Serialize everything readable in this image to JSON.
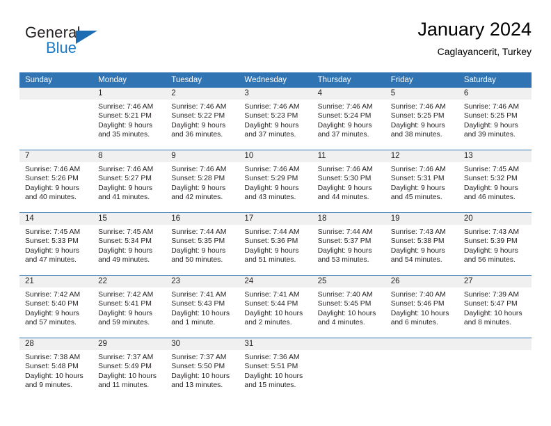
{
  "brand": {
    "name_part1": "General",
    "name_part2": "Blue",
    "logo_icon": "triangle-logo-icon",
    "accent_color": "#1c6cb3"
  },
  "header": {
    "title": "January 2024",
    "subtitle": "Caglayancerit, Turkey"
  },
  "theme": {
    "header_bg": "#3074b4",
    "daynum_bg": "#f0f0f0",
    "text": "#231f20"
  },
  "weekday_headers": [
    "Sunday",
    "Monday",
    "Tuesday",
    "Wednesday",
    "Thursday",
    "Friday",
    "Saturday"
  ],
  "weeks": [
    [
      {
        "day": "",
        "sunrise": "",
        "sunset": "",
        "daylight1": "",
        "daylight2": "",
        "blank": true
      },
      {
        "day": "1",
        "sunrise": "Sunrise: 7:46 AM",
        "sunset": "Sunset: 5:21 PM",
        "daylight1": "Daylight: 9 hours",
        "daylight2": "and 35 minutes."
      },
      {
        "day": "2",
        "sunrise": "Sunrise: 7:46 AM",
        "sunset": "Sunset: 5:22 PM",
        "daylight1": "Daylight: 9 hours",
        "daylight2": "and 36 minutes."
      },
      {
        "day": "3",
        "sunrise": "Sunrise: 7:46 AM",
        "sunset": "Sunset: 5:23 PM",
        "daylight1": "Daylight: 9 hours",
        "daylight2": "and 37 minutes."
      },
      {
        "day": "4",
        "sunrise": "Sunrise: 7:46 AM",
        "sunset": "Sunset: 5:24 PM",
        "daylight1": "Daylight: 9 hours",
        "daylight2": "and 37 minutes."
      },
      {
        "day": "5",
        "sunrise": "Sunrise: 7:46 AM",
        "sunset": "Sunset: 5:25 PM",
        "daylight1": "Daylight: 9 hours",
        "daylight2": "and 38 minutes."
      },
      {
        "day": "6",
        "sunrise": "Sunrise: 7:46 AM",
        "sunset": "Sunset: 5:25 PM",
        "daylight1": "Daylight: 9 hours",
        "daylight2": "and 39 minutes."
      }
    ],
    [
      {
        "day": "7",
        "sunrise": "Sunrise: 7:46 AM",
        "sunset": "Sunset: 5:26 PM",
        "daylight1": "Daylight: 9 hours",
        "daylight2": "and 40 minutes."
      },
      {
        "day": "8",
        "sunrise": "Sunrise: 7:46 AM",
        "sunset": "Sunset: 5:27 PM",
        "daylight1": "Daylight: 9 hours",
        "daylight2": "and 41 minutes."
      },
      {
        "day": "9",
        "sunrise": "Sunrise: 7:46 AM",
        "sunset": "Sunset: 5:28 PM",
        "daylight1": "Daylight: 9 hours",
        "daylight2": "and 42 minutes."
      },
      {
        "day": "10",
        "sunrise": "Sunrise: 7:46 AM",
        "sunset": "Sunset: 5:29 PM",
        "daylight1": "Daylight: 9 hours",
        "daylight2": "and 43 minutes."
      },
      {
        "day": "11",
        "sunrise": "Sunrise: 7:46 AM",
        "sunset": "Sunset: 5:30 PM",
        "daylight1": "Daylight: 9 hours",
        "daylight2": "and 44 minutes."
      },
      {
        "day": "12",
        "sunrise": "Sunrise: 7:46 AM",
        "sunset": "Sunset: 5:31 PM",
        "daylight1": "Daylight: 9 hours",
        "daylight2": "and 45 minutes."
      },
      {
        "day": "13",
        "sunrise": "Sunrise: 7:45 AM",
        "sunset": "Sunset: 5:32 PM",
        "daylight1": "Daylight: 9 hours",
        "daylight2": "and 46 minutes."
      }
    ],
    [
      {
        "day": "14",
        "sunrise": "Sunrise: 7:45 AM",
        "sunset": "Sunset: 5:33 PM",
        "daylight1": "Daylight: 9 hours",
        "daylight2": "and 47 minutes."
      },
      {
        "day": "15",
        "sunrise": "Sunrise: 7:45 AM",
        "sunset": "Sunset: 5:34 PM",
        "daylight1": "Daylight: 9 hours",
        "daylight2": "and 49 minutes."
      },
      {
        "day": "16",
        "sunrise": "Sunrise: 7:44 AM",
        "sunset": "Sunset: 5:35 PM",
        "daylight1": "Daylight: 9 hours",
        "daylight2": "and 50 minutes."
      },
      {
        "day": "17",
        "sunrise": "Sunrise: 7:44 AM",
        "sunset": "Sunset: 5:36 PM",
        "daylight1": "Daylight: 9 hours",
        "daylight2": "and 51 minutes."
      },
      {
        "day": "18",
        "sunrise": "Sunrise: 7:44 AM",
        "sunset": "Sunset: 5:37 PM",
        "daylight1": "Daylight: 9 hours",
        "daylight2": "and 53 minutes."
      },
      {
        "day": "19",
        "sunrise": "Sunrise: 7:43 AM",
        "sunset": "Sunset: 5:38 PM",
        "daylight1": "Daylight: 9 hours",
        "daylight2": "and 54 minutes."
      },
      {
        "day": "20",
        "sunrise": "Sunrise: 7:43 AM",
        "sunset": "Sunset: 5:39 PM",
        "daylight1": "Daylight: 9 hours",
        "daylight2": "and 56 minutes."
      }
    ],
    [
      {
        "day": "21",
        "sunrise": "Sunrise: 7:42 AM",
        "sunset": "Sunset: 5:40 PM",
        "daylight1": "Daylight: 9 hours",
        "daylight2": "and 57 minutes."
      },
      {
        "day": "22",
        "sunrise": "Sunrise: 7:42 AM",
        "sunset": "Sunset: 5:41 PM",
        "daylight1": "Daylight: 9 hours",
        "daylight2": "and 59 minutes."
      },
      {
        "day": "23",
        "sunrise": "Sunrise: 7:41 AM",
        "sunset": "Sunset: 5:43 PM",
        "daylight1": "Daylight: 10 hours",
        "daylight2": "and 1 minute."
      },
      {
        "day": "24",
        "sunrise": "Sunrise: 7:41 AM",
        "sunset": "Sunset: 5:44 PM",
        "daylight1": "Daylight: 10 hours",
        "daylight2": "and 2 minutes."
      },
      {
        "day": "25",
        "sunrise": "Sunrise: 7:40 AM",
        "sunset": "Sunset: 5:45 PM",
        "daylight1": "Daylight: 10 hours",
        "daylight2": "and 4 minutes."
      },
      {
        "day": "26",
        "sunrise": "Sunrise: 7:40 AM",
        "sunset": "Sunset: 5:46 PM",
        "daylight1": "Daylight: 10 hours",
        "daylight2": "and 6 minutes."
      },
      {
        "day": "27",
        "sunrise": "Sunrise: 7:39 AM",
        "sunset": "Sunset: 5:47 PM",
        "daylight1": "Daylight: 10 hours",
        "daylight2": "and 8 minutes."
      }
    ],
    [
      {
        "day": "28",
        "sunrise": "Sunrise: 7:38 AM",
        "sunset": "Sunset: 5:48 PM",
        "daylight1": "Daylight: 10 hours",
        "daylight2": "and 9 minutes."
      },
      {
        "day": "29",
        "sunrise": "Sunrise: 7:37 AM",
        "sunset": "Sunset: 5:49 PM",
        "daylight1": "Daylight: 10 hours",
        "daylight2": "and 11 minutes."
      },
      {
        "day": "30",
        "sunrise": "Sunrise: 7:37 AM",
        "sunset": "Sunset: 5:50 PM",
        "daylight1": "Daylight: 10 hours",
        "daylight2": "and 13 minutes."
      },
      {
        "day": "31",
        "sunrise": "Sunrise: 7:36 AM",
        "sunset": "Sunset: 5:51 PM",
        "daylight1": "Daylight: 10 hours",
        "daylight2": "and 15 minutes."
      },
      {
        "day": "",
        "sunrise": "",
        "sunset": "",
        "daylight1": "",
        "daylight2": "",
        "blank": true
      },
      {
        "day": "",
        "sunrise": "",
        "sunset": "",
        "daylight1": "",
        "daylight2": "",
        "blank": true
      },
      {
        "day": "",
        "sunrise": "",
        "sunset": "",
        "daylight1": "",
        "daylight2": "",
        "blank": true
      }
    ]
  ]
}
